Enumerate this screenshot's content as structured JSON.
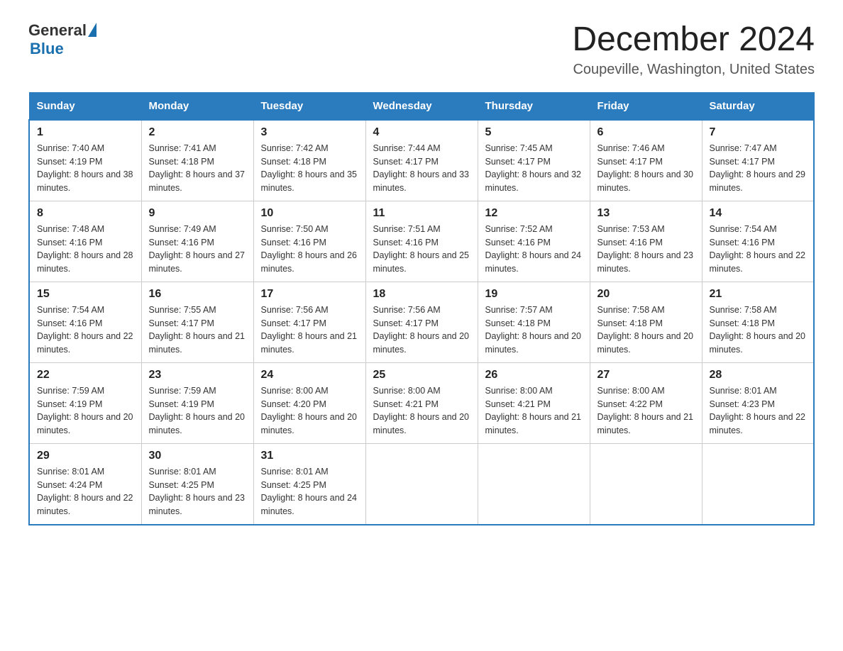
{
  "header": {
    "logo_general": "General",
    "logo_blue": "Blue",
    "title": "December 2024",
    "location": "Coupeville, Washington, United States"
  },
  "days_of_week": [
    "Sunday",
    "Monday",
    "Tuesday",
    "Wednesday",
    "Thursday",
    "Friday",
    "Saturday"
  ],
  "weeks": [
    [
      {
        "num": "1",
        "sunrise": "7:40 AM",
        "sunset": "4:19 PM",
        "daylight": "8 hours and 38 minutes."
      },
      {
        "num": "2",
        "sunrise": "7:41 AM",
        "sunset": "4:18 PM",
        "daylight": "8 hours and 37 minutes."
      },
      {
        "num": "3",
        "sunrise": "7:42 AM",
        "sunset": "4:18 PM",
        "daylight": "8 hours and 35 minutes."
      },
      {
        "num": "4",
        "sunrise": "7:44 AM",
        "sunset": "4:17 PM",
        "daylight": "8 hours and 33 minutes."
      },
      {
        "num": "5",
        "sunrise": "7:45 AM",
        "sunset": "4:17 PM",
        "daylight": "8 hours and 32 minutes."
      },
      {
        "num": "6",
        "sunrise": "7:46 AM",
        "sunset": "4:17 PM",
        "daylight": "8 hours and 30 minutes."
      },
      {
        "num": "7",
        "sunrise": "7:47 AM",
        "sunset": "4:17 PM",
        "daylight": "8 hours and 29 minutes."
      }
    ],
    [
      {
        "num": "8",
        "sunrise": "7:48 AM",
        "sunset": "4:16 PM",
        "daylight": "8 hours and 28 minutes."
      },
      {
        "num": "9",
        "sunrise": "7:49 AM",
        "sunset": "4:16 PM",
        "daylight": "8 hours and 27 minutes."
      },
      {
        "num": "10",
        "sunrise": "7:50 AM",
        "sunset": "4:16 PM",
        "daylight": "8 hours and 26 minutes."
      },
      {
        "num": "11",
        "sunrise": "7:51 AM",
        "sunset": "4:16 PM",
        "daylight": "8 hours and 25 minutes."
      },
      {
        "num": "12",
        "sunrise": "7:52 AM",
        "sunset": "4:16 PM",
        "daylight": "8 hours and 24 minutes."
      },
      {
        "num": "13",
        "sunrise": "7:53 AM",
        "sunset": "4:16 PM",
        "daylight": "8 hours and 23 minutes."
      },
      {
        "num": "14",
        "sunrise": "7:54 AM",
        "sunset": "4:16 PM",
        "daylight": "8 hours and 22 minutes."
      }
    ],
    [
      {
        "num": "15",
        "sunrise": "7:54 AM",
        "sunset": "4:16 PM",
        "daylight": "8 hours and 22 minutes."
      },
      {
        "num": "16",
        "sunrise": "7:55 AM",
        "sunset": "4:17 PM",
        "daylight": "8 hours and 21 minutes."
      },
      {
        "num": "17",
        "sunrise": "7:56 AM",
        "sunset": "4:17 PM",
        "daylight": "8 hours and 21 minutes."
      },
      {
        "num": "18",
        "sunrise": "7:56 AM",
        "sunset": "4:17 PM",
        "daylight": "8 hours and 20 minutes."
      },
      {
        "num": "19",
        "sunrise": "7:57 AM",
        "sunset": "4:18 PM",
        "daylight": "8 hours and 20 minutes."
      },
      {
        "num": "20",
        "sunrise": "7:58 AM",
        "sunset": "4:18 PM",
        "daylight": "8 hours and 20 minutes."
      },
      {
        "num": "21",
        "sunrise": "7:58 AM",
        "sunset": "4:18 PM",
        "daylight": "8 hours and 20 minutes."
      }
    ],
    [
      {
        "num": "22",
        "sunrise": "7:59 AM",
        "sunset": "4:19 PM",
        "daylight": "8 hours and 20 minutes."
      },
      {
        "num": "23",
        "sunrise": "7:59 AM",
        "sunset": "4:19 PM",
        "daylight": "8 hours and 20 minutes."
      },
      {
        "num": "24",
        "sunrise": "8:00 AM",
        "sunset": "4:20 PM",
        "daylight": "8 hours and 20 minutes."
      },
      {
        "num": "25",
        "sunrise": "8:00 AM",
        "sunset": "4:21 PM",
        "daylight": "8 hours and 20 minutes."
      },
      {
        "num": "26",
        "sunrise": "8:00 AM",
        "sunset": "4:21 PM",
        "daylight": "8 hours and 21 minutes."
      },
      {
        "num": "27",
        "sunrise": "8:00 AM",
        "sunset": "4:22 PM",
        "daylight": "8 hours and 21 minutes."
      },
      {
        "num": "28",
        "sunrise": "8:01 AM",
        "sunset": "4:23 PM",
        "daylight": "8 hours and 22 minutes."
      }
    ],
    [
      {
        "num": "29",
        "sunrise": "8:01 AM",
        "sunset": "4:24 PM",
        "daylight": "8 hours and 22 minutes."
      },
      {
        "num": "30",
        "sunrise": "8:01 AM",
        "sunset": "4:25 PM",
        "daylight": "8 hours and 23 minutes."
      },
      {
        "num": "31",
        "sunrise": "8:01 AM",
        "sunset": "4:25 PM",
        "daylight": "8 hours and 24 minutes."
      },
      null,
      null,
      null,
      null
    ]
  ]
}
